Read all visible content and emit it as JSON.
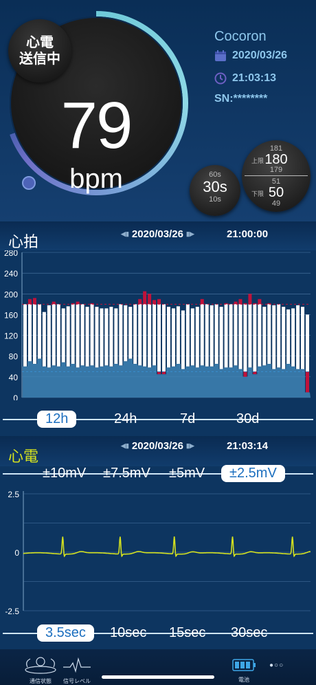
{
  "status": {
    "sending_line1": "心電",
    "sending_line2": "送信中",
    "bpm_value": "79",
    "bpm_unit": "bpm",
    "ring_fraction": 0.69
  },
  "device": {
    "brand": "Cocoron",
    "date": "2020/03/26",
    "time": "21:03:13",
    "sn": "SN:********"
  },
  "interval_dial": {
    "top": "60s",
    "value": "30s",
    "bottom": "10s"
  },
  "limit_dial": {
    "upper_top": "181",
    "upper_label": "上限",
    "upper_value": "180",
    "upper_below": "179",
    "lower_top": "51",
    "lower_label": "下限",
    "lower_value": "50",
    "lower_below": "49"
  },
  "heart_rate": {
    "title": "心拍",
    "date": "2020/03/26",
    "time": "21:00:00",
    "tabs": [
      "12h",
      "24h",
      "7d",
      "30d"
    ],
    "selected_tab": "12h"
  },
  "ecg": {
    "title": "心電",
    "date": "2020/03/26",
    "time": "21:03:14",
    "scale_tabs": [
      "±10mV",
      "±7.5mV",
      "±5mV",
      "±2.5mV"
    ],
    "selected_scale": "±2.5mV",
    "duration_tabs": [
      "3.5sec",
      "10sec",
      "15sec",
      "30sec"
    ],
    "selected_duration": "3.5sec"
  },
  "bottom_nav": {
    "comm_label": "通信状態",
    "signal_label": "信号レベル",
    "battery_label": "電池"
  },
  "colors": {
    "background": "#0d3560",
    "accent_ecg": "#d4e11f",
    "alarm_red": "#c0123a",
    "area_blue": "#3f83b4"
  },
  "chart_data": [
    {
      "type": "bar",
      "title": "心拍",
      "ylim": [
        0,
        280
      ],
      "yticks": [
        0,
        40,
        80,
        120,
        160,
        200,
        240,
        280
      ],
      "upper_limit": 180,
      "lower_limit": 50,
      "series": [
        {
          "values_max": [
            180,
            190,
            192,
            180,
            165,
            178,
            185,
            180,
            172,
            176,
            182,
            185,
            180,
            175,
            182,
            175,
            172,
            172,
            175,
            172,
            180,
            178,
            175,
            180,
            190,
            205,
            200,
            188,
            190,
            180,
            175,
            172,
            176,
            168,
            180,
            172,
            175,
            190,
            180,
            178,
            180,
            175,
            182,
            180,
            185,
            190,
            182,
            200,
            182,
            190,
            175,
            182,
            178,
            180,
            175,
            170,
            172,
            178,
            175,
            160
          ],
          "values_min": [
            60,
            70,
            65,
            75,
            60,
            58,
            62,
            60,
            68,
            60,
            65,
            58,
            62,
            60,
            62,
            58,
            60,
            62,
            60,
            65,
            62,
            70,
            75,
            65,
            62,
            60,
            58,
            62,
            45,
            45,
            58,
            60,
            65,
            55,
            60,
            62,
            58,
            62,
            60,
            60,
            65,
            55,
            58,
            58,
            62,
            55,
            40,
            58,
            45,
            60,
            62,
            65,
            55,
            58,
            55,
            65,
            60,
            55,
            55,
            10
          ]
        }
      ]
    },
    {
      "type": "line",
      "title": "心電",
      "ylim": [
        -2.5,
        2.5
      ],
      "yticks": [
        "2.5",
        "0",
        "-2.5"
      ],
      "x_seconds": 3.5,
      "r_peaks_seconds": [
        0.48,
        1.18,
        1.84,
        2.55,
        3.28
      ],
      "r_peak_mv": 0.75,
      "baseline_mv": 0
    }
  ]
}
